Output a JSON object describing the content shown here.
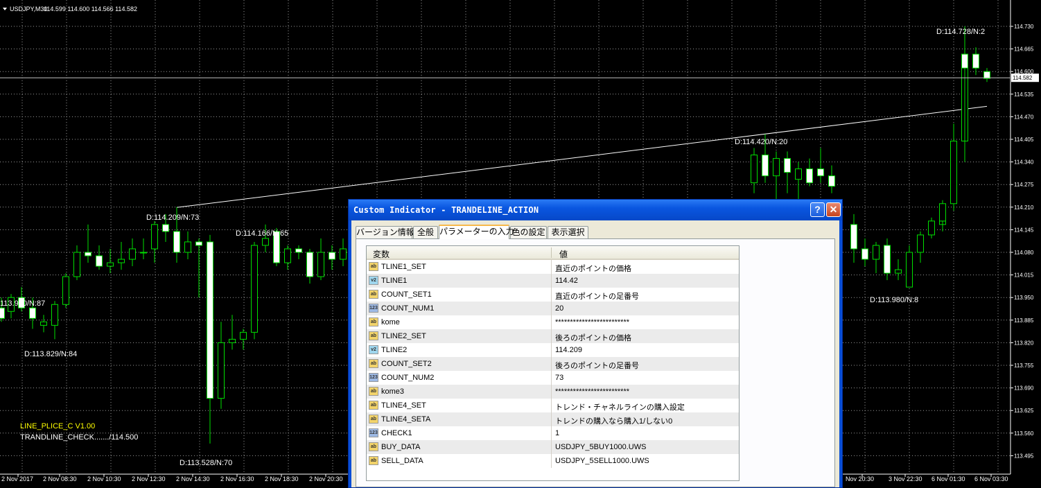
{
  "chart_header": {
    "symbol": "USDJPY,M30",
    "ohlc": "114.599 114.600 114.566 114.582"
  },
  "price_axis": {
    "labels": [
      "114.730",
      "114.665",
      "114.600",
      "114.535",
      "114.470",
      "114.405",
      "114.340",
      "114.275",
      "114.210",
      "114.145",
      "114.080",
      "114.015",
      "113.950",
      "113.885",
      "113.820",
      "113.755",
      "113.690",
      "113.625",
      "113.560",
      "113.495"
    ],
    "current_price": "114.582"
  },
  "time_axis": {
    "labels": [
      "2 Nov 2017",
      "2 Nov 08:30",
      "2 Nov 10:30",
      "2 Nov 12:30",
      "2 Nov 14:30",
      "2 Nov 16:30",
      "2 Nov 18:30",
      "2 Nov 20:30",
      "Nov 20:30",
      "3 Nov 22:30",
      "6 Nov 01:30",
      "6 Nov 03:30"
    ]
  },
  "annotations": [
    {
      "text": "D:114.728/N:2",
      "color": "#ffffff"
    },
    {
      "text": "D:114.420/N:20",
      "color": "#ffffff"
    },
    {
      "text": "D:114.209/N:73",
      "color": "#ffffff"
    },
    {
      "text": "D:114.166/N:65",
      "color": "#ffffff"
    },
    {
      "text": "113.970/N:87",
      "color": "#ffffff"
    },
    {
      "text": "D:113.829/N:84",
      "color": "#ffffff"
    },
    {
      "text": "D:113.980/N:8",
      "color": "#ffffff"
    },
    {
      "text": "D:113.528/N:70",
      "color": "#ffffff"
    },
    {
      "text": "LINE_PLICE_C V1.00",
      "color": "#ffff00"
    },
    {
      "text": "TRANDLINE_CHECK......./114.500",
      "color": "#ffffff"
    }
  ],
  "trendline": {
    "from_price": 114.209,
    "to_price": 114.5
  },
  "candles": [
    {
      "o": 113.92,
      "h": 113.95,
      "l": 113.88,
      "c": 113.89
    },
    {
      "o": 113.91,
      "h": 113.96,
      "l": 113.89,
      "c": 113.95
    },
    {
      "o": 113.95,
      "h": 113.98,
      "l": 113.91,
      "c": 113.92
    },
    {
      "o": 113.92,
      "h": 113.95,
      "l": 113.86,
      "c": 113.89
    },
    {
      "o": 113.87,
      "h": 113.9,
      "l": 113.85,
      "c": 113.88
    },
    {
      "o": 113.87,
      "h": 113.94,
      "l": 113.83,
      "c": 113.93
    },
    {
      "o": 113.93,
      "h": 114.02,
      "l": 113.92,
      "c": 114.01
    },
    {
      "o": 114.01,
      "h": 114.1,
      "l": 114.0,
      "c": 114.08
    },
    {
      "o": 114.08,
      "h": 114.16,
      "l": 114.05,
      "c": 114.07
    },
    {
      "o": 114.07,
      "h": 114.1,
      "l": 114.03,
      "c": 114.04
    },
    {
      "o": 114.04,
      "h": 114.09,
      "l": 114.02,
      "c": 114.05
    },
    {
      "o": 114.05,
      "h": 114.11,
      "l": 114.03,
      "c": 114.06
    },
    {
      "o": 114.06,
      "h": 114.12,
      "l": 114.04,
      "c": 114.09
    },
    {
      "o": 114.08,
      "h": 114.12,
      "l": 114.06,
      "c": 114.08
    },
    {
      "o": 114.09,
      "h": 114.17,
      "l": 114.05,
      "c": 114.16
    },
    {
      "o": 114.16,
      "h": 114.19,
      "l": 114.11,
      "c": 114.14
    },
    {
      "o": 114.14,
      "h": 114.21,
      "l": 114.05,
      "c": 114.08
    },
    {
      "o": 114.08,
      "h": 114.14,
      "l": 114.06,
      "c": 114.11
    },
    {
      "o": 114.11,
      "h": 114.12,
      "l": 113.95,
      "c": 114.1
    },
    {
      "o": 114.11,
      "h": 114.13,
      "l": 113.53,
      "c": 113.66
    },
    {
      "o": 113.66,
      "h": 113.88,
      "l": 113.63,
      "c": 113.82
    },
    {
      "o": 113.82,
      "h": 113.9,
      "l": 113.8,
      "c": 113.83
    },
    {
      "o": 113.83,
      "h": 113.86,
      "l": 113.8,
      "c": 113.85
    },
    {
      "o": 113.85,
      "h": 114.11,
      "l": 113.83,
      "c": 114.1
    },
    {
      "o": 114.1,
      "h": 114.16,
      "l": 114.08,
      "c": 114.12
    },
    {
      "o": 114.14,
      "h": 114.15,
      "l": 114.04,
      "c": 114.05
    },
    {
      "o": 114.05,
      "h": 114.1,
      "l": 114.03,
      "c": 114.09
    },
    {
      "o": 114.09,
      "h": 114.1,
      "l": 114.06,
      "c": 114.08
    },
    {
      "o": 114.08,
      "h": 114.09,
      "l": 113.99,
      "c": 114.01
    },
    {
      "o": 114.01,
      "h": 114.12,
      "l": 114.0,
      "c": 114.08
    },
    {
      "o": 114.08,
      "h": 114.1,
      "l": 114.03,
      "c": 114.06
    },
    {
      "o": 114.06,
      "h": 114.12,
      "l": 114.04,
      "c": 114.09
    },
    {
      "o": 114.28,
      "h": 114.38,
      "l": 114.25,
      "c": 114.36
    },
    {
      "o": 114.36,
      "h": 114.42,
      "l": 114.28,
      "c": 114.3
    },
    {
      "o": 114.3,
      "h": 114.37,
      "l": 114.22,
      "c": 114.35
    },
    {
      "o": 114.35,
      "h": 114.37,
      "l": 114.25,
      "c": 114.31
    },
    {
      "o": 114.29,
      "h": 114.34,
      "l": 114.21,
      "c": 114.32
    },
    {
      "o": 114.32,
      "h": 114.35,
      "l": 114.27,
      "c": 114.28
    },
    {
      "o": 114.32,
      "h": 114.38,
      "l": 114.28,
      "c": 114.3
    },
    {
      "o": 114.3,
      "h": 114.33,
      "l": 114.25,
      "c": 114.27
    },
    {
      "o": 114.16,
      "h": 114.19,
      "l": 114.05,
      "c": 114.09
    },
    {
      "o": 114.09,
      "h": 114.12,
      "l": 114.04,
      "c": 114.06
    },
    {
      "o": 114.06,
      "h": 114.11,
      "l": 114.02,
      "c": 114.1
    },
    {
      "o": 114.1,
      "h": 114.12,
      "l": 114.0,
      "c": 114.02
    },
    {
      "o": 114.02,
      "h": 114.06,
      "l": 114.0,
      "c": 114.03
    },
    {
      "o": 113.98,
      "h": 114.1,
      "l": 113.98,
      "c": 114.08
    },
    {
      "o": 114.08,
      "h": 114.14,
      "l": 114.05,
      "c": 114.13
    },
    {
      "o": 114.13,
      "h": 114.18,
      "l": 114.12,
      "c": 114.17
    },
    {
      "o": 114.16,
      "h": 114.19,
      "l": 114.14,
      "c": 114.17
    },
    {
      "o": 114.17,
      "h": 114.23,
      "l": 114.15,
      "c": 114.22
    },
    {
      "o": 114.22,
      "h": 114.45,
      "l": 114.2,
      "c": 114.4
    },
    {
      "o": 114.4,
      "h": 114.5,
      "l": 114.34,
      "c": 114.65
    },
    {
      "o": 114.65,
      "h": 114.73,
      "l": 114.35,
      "c": 114.61
    },
    {
      "o": 114.65,
      "h": 114.67,
      "l": 114.59,
      "c": 114.61
    },
    {
      "o": 114.6,
      "h": 114.61,
      "l": 114.57,
      "c": 114.58
    }
  ],
  "dialog": {
    "title": "Custom Indicator - TRANDELINE_ACTION",
    "help_label": "?",
    "close_label": "✕",
    "tabs": [
      {
        "label": "バージョン情報"
      },
      {
        "label": "全般"
      },
      {
        "label": "パラメーターの入力"
      },
      {
        "label": "色の設定"
      },
      {
        "label": "表示選択"
      }
    ],
    "active_tab": "パラメーターの入力",
    "columns": {
      "name": "変数",
      "value": "値"
    },
    "params": [
      {
        "type": "ab",
        "name": "TLINE1_SET",
        "value": "直近のポイントの価格"
      },
      {
        "type": "v2",
        "name": "TLINE1",
        "value": "114.42"
      },
      {
        "type": "ab",
        "name": "COUNT_SET1",
        "value": "直近のポイントの足番号"
      },
      {
        "type": "123",
        "name": "COUNT_NUM1",
        "value": "20"
      },
      {
        "type": "ab",
        "name": "kome",
        "value": "*************************"
      },
      {
        "type": "ab",
        "name": "TLINE2_SET",
        "value": "後ろのポイントの価格"
      },
      {
        "type": "v2",
        "name": "TLINE2",
        "value": "114.209"
      },
      {
        "type": "ab",
        "name": "COUNT_SET2",
        "value": "後ろのポイントの足番号"
      },
      {
        "type": "123",
        "name": "COUNT_NUM2",
        "value": "73"
      },
      {
        "type": "ab",
        "name": "kome3",
        "value": "*************************"
      },
      {
        "type": "ab",
        "name": "TLINE4_SET",
        "value": "トレンド・チャネルラインの購入設定"
      },
      {
        "type": "ab",
        "name": "TLINE4_SETA",
        "value": "トレンドの購入なら購入1/しない0"
      },
      {
        "type": "123",
        "name": "CHECK1",
        "value": "1"
      },
      {
        "type": "ab",
        "name": "BUY_DATA",
        "value": "USDJPY_5BUY1000.UWS"
      },
      {
        "type": "ab",
        "name": "SELL_DATA",
        "value": "USDJPY_5SELL1000.UWS"
      }
    ]
  }
}
